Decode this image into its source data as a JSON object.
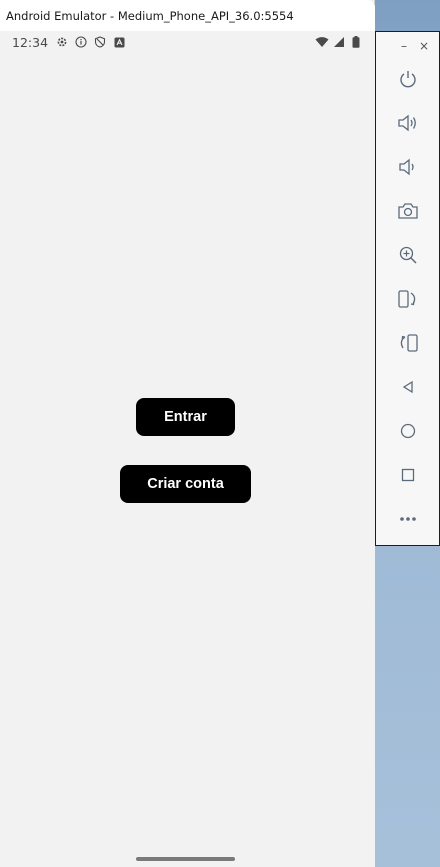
{
  "window": {
    "title": "Android Emulator - Medium_Phone_API_36.0:5554"
  },
  "statusbar": {
    "time": "12:34",
    "left_icons": [
      "settings-icon",
      "info-icon",
      "shield-icon",
      "app-a-icon"
    ],
    "right_icons": [
      "wifi-icon",
      "signal-icon",
      "battery-icon"
    ]
  },
  "app": {
    "login_label": "Entrar",
    "create_account_label": "Criar conta",
    "button_color": "#000000",
    "button_text_color": "#ffffff",
    "background_color": "#f2f2f2"
  },
  "toolbar": {
    "minimize_label": "–",
    "close_label": "×",
    "buttons": [
      "power-icon",
      "volume-up-icon",
      "volume-down-icon",
      "camera-icon",
      "zoom-icon",
      "rotate-left-icon",
      "rotate-right-icon",
      "back-icon",
      "home-icon",
      "overview-icon",
      "more-icon"
    ]
  }
}
